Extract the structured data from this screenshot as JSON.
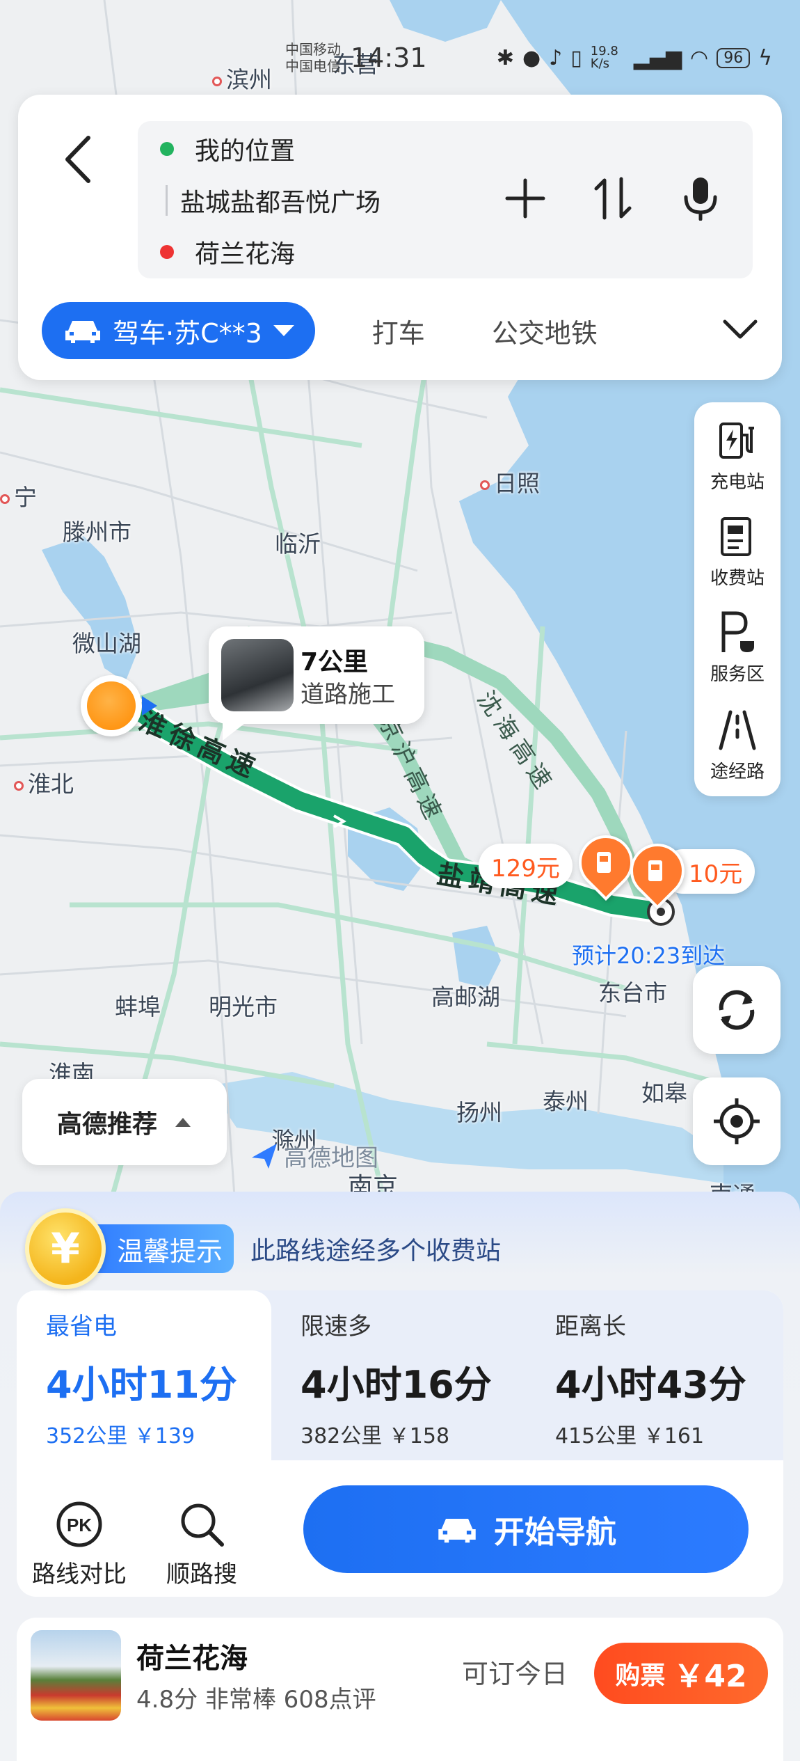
{
  "status_bar": {
    "carrier1": "中国移动",
    "carrier2": "中国电信",
    "time": "14:31",
    "net_speed": "19.8 K/s",
    "battery": "96"
  },
  "map": {
    "cities": {
      "binzhou": "滨州",
      "dongying": "东营",
      "tengzhou": "滕州市",
      "linyi": "临沂",
      "rizhao": "日照",
      "weishanhu": "微山湖",
      "huaibei": "淮北",
      "bengbu": "蚌埠",
      "mingguang": "明光市",
      "gaoyouhu": "高邮湖",
      "dongtai": "东台市",
      "yangzhou": "扬州",
      "taizhou": "泰州",
      "rugao": "如皋",
      "huainan": "淮南",
      "chuzhou": "滁州",
      "nanjing": "南京",
      "nantong": "南通",
      "ning": "宁"
    },
    "roads": {
      "huaixu": "淮徐高速",
      "shenhai": "沈海高速",
      "yanjing": "盐靖高速",
      "jingbin": "京沪高速"
    },
    "incident": {
      "distance": "7公里",
      "type": "道路施工"
    },
    "tolls": {
      "left": "129元",
      "right": "10元"
    },
    "eta": "预计20:23到达",
    "recommend_label": "高德推荐",
    "logo_text": "高德地图"
  },
  "search": {
    "origin": "我的位置",
    "via": "盐城盐都吾悦广场",
    "destination": "荷兰花海"
  },
  "modes": {
    "drive": "驾车·苏C**3",
    "taxi": "打车",
    "transit": "公交地铁"
  },
  "side_tools": [
    {
      "label": "充电站",
      "icon": "charging-station-icon"
    },
    {
      "label": "收费站",
      "icon": "toll-station-icon"
    },
    {
      "label": "服务区",
      "icon": "service-area-icon"
    },
    {
      "label": "途经路",
      "icon": "via-road-icon"
    }
  ],
  "tip": {
    "badge": "温馨提示",
    "text": "此路线途经多个收费站"
  },
  "routes": [
    {
      "tag": "最省电",
      "duration": "4小时11分",
      "meta": "352公里 ￥139"
    },
    {
      "tag": "限速多",
      "duration": "4小时16分",
      "meta": "382公里 ￥158"
    },
    {
      "tag": "距离长",
      "duration": "4小时43分",
      "meta": "415公里 ￥161"
    }
  ],
  "actions": {
    "compare": "路线对比",
    "along_search": "顺路搜",
    "start_nav": "开始导航"
  },
  "poi": {
    "name": "荷兰花海",
    "rating": "4.8分 非常棒 608点评",
    "available": "可订今日",
    "buy_label": "购票",
    "price": "￥42"
  },
  "colors": {
    "accent": "#1d6ff2",
    "route_green": "#1aa36b",
    "route_alt": "#9ed8bd",
    "toll_orange": "#ff5a1f",
    "water": "#a8d3f0"
  }
}
